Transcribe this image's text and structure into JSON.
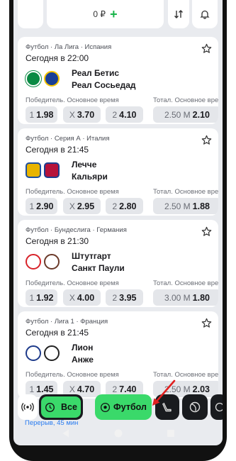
{
  "topbar": {
    "balance": "0 ₽",
    "plus": "+"
  },
  "events": [
    {
      "league": "Футбол · Ла Лига · Испания",
      "time": "Сегодня в 22:00",
      "team1": "Реал Бетис",
      "team2": "Реал Сосьедад",
      "market1": "Победитель. Основное время",
      "market2": "Тотал. Основное время",
      "odds": [
        {
          "label": "1",
          "value": "1.98"
        },
        {
          "label": "X",
          "value": "3.70"
        },
        {
          "label": "2",
          "value": "4.10"
        },
        {
          "label": "2.50 М",
          "value": "2.10"
        }
      ],
      "logo1_color": "#0a8a44",
      "logo2_color": "#1a3f95"
    },
    {
      "league": "Футбол · Серия А · Италия",
      "time": "Сегодня в 21:45",
      "team1": "Лечче",
      "team2": "Кальяри",
      "market1": "Победитель. Основное время",
      "market2": "Тотал. Основное время",
      "odds": [
        {
          "label": "1",
          "value": "2.90"
        },
        {
          "label": "X",
          "value": "2.95"
        },
        {
          "label": "2",
          "value": "2.80"
        },
        {
          "label": "2.50 М",
          "value": "1.88"
        }
      ],
      "logo1_color": "#e8b400",
      "logo2_color": "#b5123a"
    },
    {
      "league": "Футбол · Бундеслига · Германия",
      "time": "Сегодня в 21:30",
      "team1": "Штутгарт",
      "team2": "Санкт Паули",
      "market1": "Победитель. Основное время",
      "market2": "Тотал. Основное время",
      "odds": [
        {
          "label": "1",
          "value": "1.92"
        },
        {
          "label": "X",
          "value": "4.00"
        },
        {
          "label": "2",
          "value": "3.95"
        },
        {
          "label": "3.00 М",
          "value": "1.80"
        }
      ],
      "logo1_color": "#d8232a",
      "logo2_color": "#6b3a2a"
    },
    {
      "league": "Футбол · Лига 1 · Франция",
      "time": "Сегодня в 21:45",
      "team1": "Лион",
      "team2": "Анже",
      "market1": "Победитель. Основное время",
      "market2": "Тотал. Основное время",
      "odds": [
        {
          "label": "1",
          "value": "1.45"
        },
        {
          "label": "X",
          "value": "4.70"
        },
        {
          "label": "2",
          "value": "7.40"
        },
        {
          "label": "2.50 М",
          "value": "2.03"
        }
      ],
      "logo1_color": "#1d3a8a",
      "logo2_color": "#222222"
    }
  ],
  "bottombar": {
    "all_label": "Все",
    "football_label": "Футбол"
  },
  "underlay_text": "Перерыв, 45 мин",
  "colors": {
    "accent_green": "#3ad96a",
    "dark": "#191b1f",
    "odds_bg": "#e4e6ea"
  }
}
